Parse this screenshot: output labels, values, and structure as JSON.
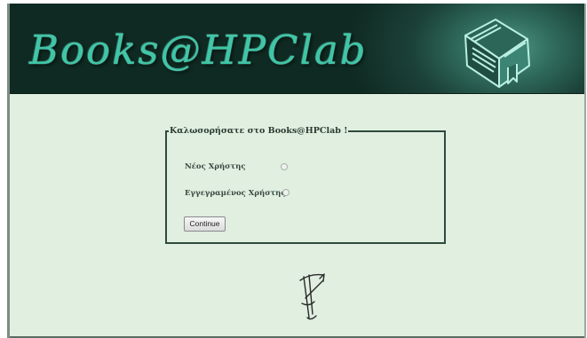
{
  "header": {
    "logo_text": "Books@HPClab",
    "book_icon": "book-icon"
  },
  "welcome": {
    "legend": "Καλωσορήσατε στο Books@HPClab !",
    "options": [
      {
        "label": "Νέος Χρήστης",
        "selected": false
      },
      {
        "label": "Εγγεγραμένος Χρήστης",
        "selected": false
      }
    ],
    "continue_label": "Continue"
  },
  "footer": {
    "signature_icon": "signature-logo"
  },
  "colors": {
    "page_bg": "#e0efe0",
    "header_dark": "#0f2a22",
    "logo_text": "#3ec6a7",
    "fieldset_border": "#2f4a3e"
  }
}
